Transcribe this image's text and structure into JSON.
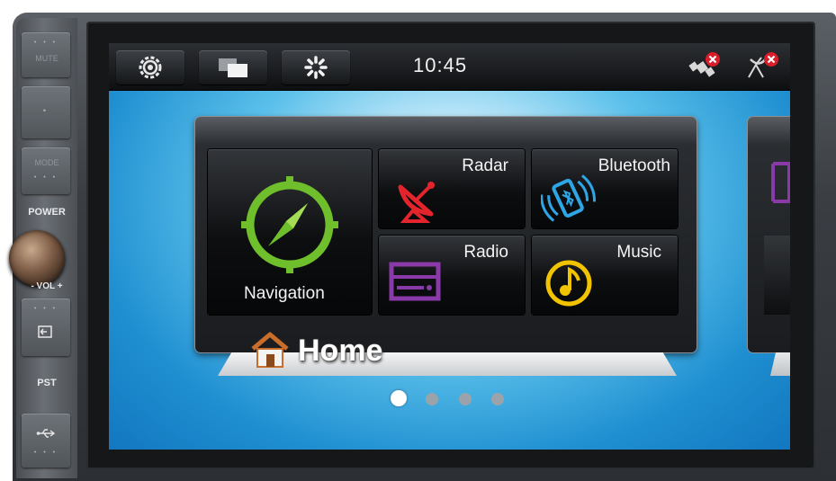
{
  "hardware": {
    "mute_label": "MUTE",
    "mode_label": "MODE",
    "power_label": "POWER",
    "vol_label": "- VOL +",
    "pst_label": "PST"
  },
  "statusbar": {
    "time": "10:45",
    "buttons": [
      "settings",
      "windows",
      "brightness"
    ],
    "status_icons": [
      "gps-disconnected",
      "satellite-disconnected"
    ]
  },
  "launcher": {
    "tiles": [
      {
        "label": "Navigation",
        "icon": "compass-icon",
        "color": "#6fbf2c"
      },
      {
        "label": "Radar",
        "icon": "satellite-dish-icon",
        "color": "#e4242c"
      },
      {
        "label": "Bluetooth",
        "icon": "bluetooth-phone-icon",
        "color": "#2ea6e6"
      },
      {
        "label": "Radio",
        "icon": "radio-icon",
        "color": "#8a3aa8"
      },
      {
        "label": "Music",
        "icon": "music-note-icon",
        "color": "#f2c400"
      }
    ],
    "page_title": "Home"
  },
  "pager": {
    "count": 4,
    "active": 1
  },
  "colors": {
    "accent": "#1f8fd1",
    "status_error": "#d81e2a"
  }
}
